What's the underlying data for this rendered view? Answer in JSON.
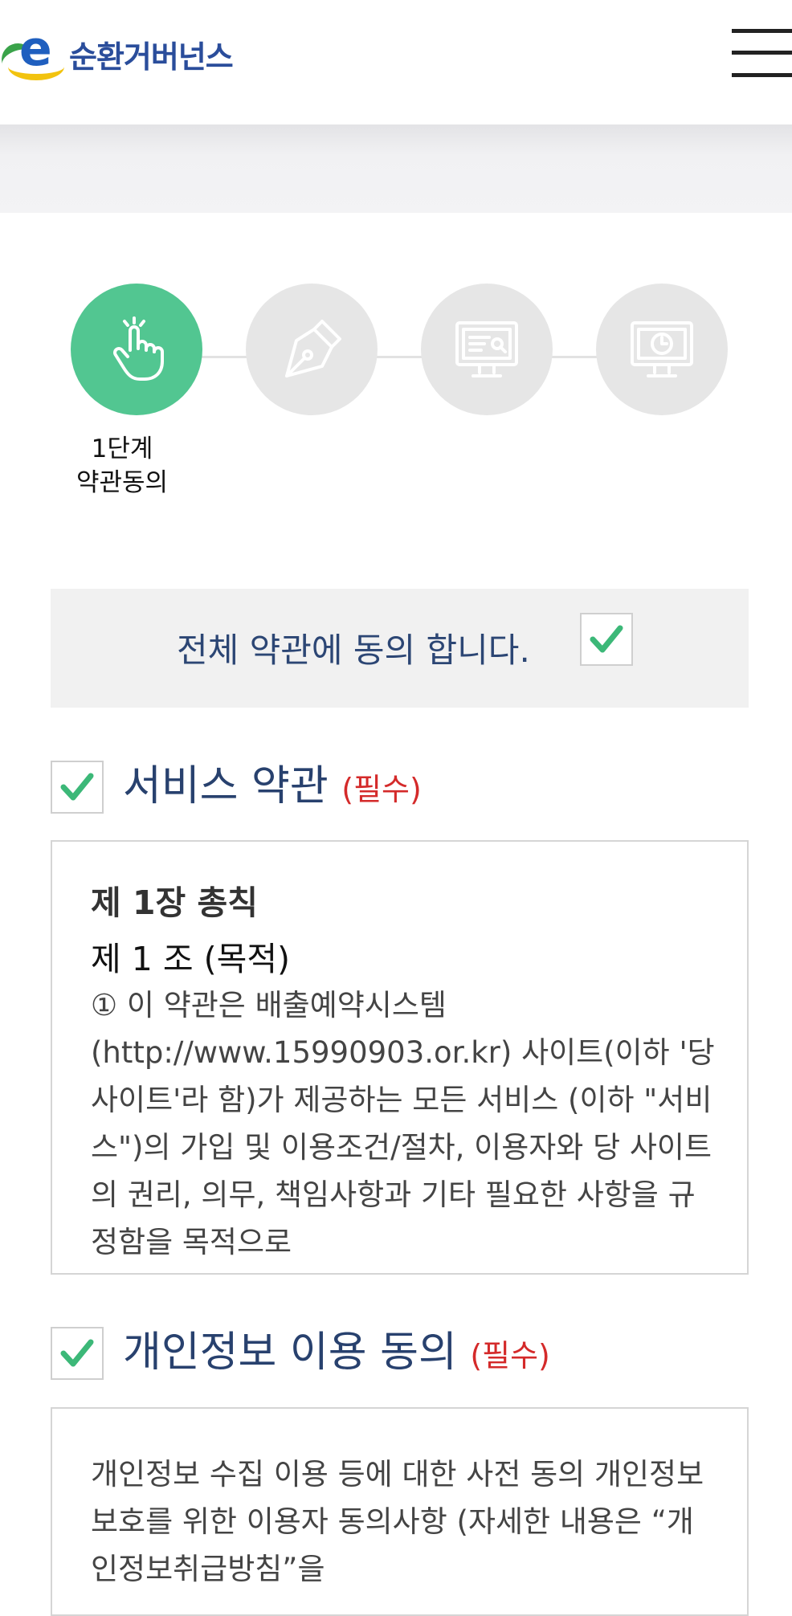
{
  "header": {
    "logo_letter": "e",
    "logo_text": "순환거버넌스",
    "menu_icon": "hamburger-menu-icon"
  },
  "steps": {
    "items": [
      {
        "icon": "tap-hand-icon",
        "active": true
      },
      {
        "icon": "pen-nib-icon",
        "active": false
      },
      {
        "icon": "monitor-search-icon",
        "active": false
      },
      {
        "icon": "monitor-clock-icon",
        "active": false
      }
    ],
    "active_label_line1": "1단계",
    "active_label_line2": "약관동의"
  },
  "agree_all": {
    "label": "전체 약관에 동의 합니다.",
    "checked": true
  },
  "service_terms": {
    "title": "서비스 약관",
    "required": "(필수)",
    "checked": true,
    "chapter": "제 1장 총칙",
    "article": "제 1 조 (목적)",
    "body": "① 이 약관은 배출예약시스템 (http://www.15990903.or.kr) 사이트(이하 '당 사이트'라 함)가 제공하는 모든 서비스 (이하 \"서비스\")의 가입 및 이용조건/절차, 이용자와 당 사이트의 권리, 의무, 책임사항과 기타 필요한 사항을 규정함을 목적으로"
  },
  "privacy_terms": {
    "title": "개인정보 이용 동의",
    "required": "(필수)",
    "checked": true,
    "body": "개인정보 수집 이용 등에 대한 사전 동의 개인정보보호를 위한 이용자 동의사항 (자세한 내용은 “개인정보취급방침”을"
  },
  "colors": {
    "accent_green": "#52c691",
    "step_inactive": "#e6e6e6",
    "title_navy": "#28416e",
    "required_red": "#d42a2a",
    "check_green": "#3cb878"
  }
}
